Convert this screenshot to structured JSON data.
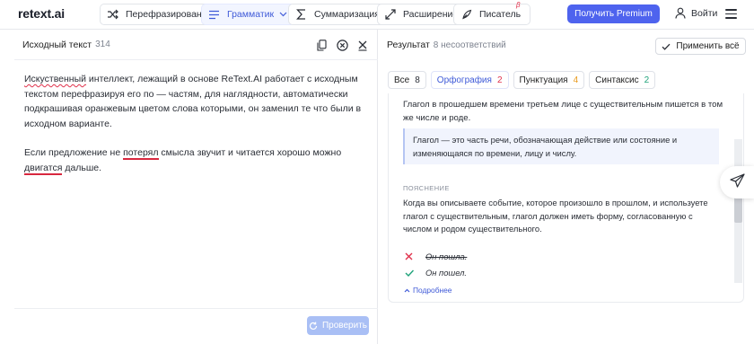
{
  "header": {
    "logo": "retext.ai",
    "nav": [
      {
        "label": "Перефразирование",
        "icon": "shuffle-icon"
      },
      {
        "label": "Грамматик",
        "icon": "text-lines-icon",
        "active": true
      },
      {
        "label": "Суммаризация",
        "icon": "sigma-icon"
      },
      {
        "label": "Расширение",
        "icon": "expand-arrows-icon"
      },
      {
        "label": "Писатель",
        "icon": "quill-icon",
        "badge": "β"
      }
    ],
    "premium_label": "Получить Premium",
    "login_label": "Войти"
  },
  "source_panel": {
    "title": "Исходный текст",
    "count": "314",
    "paragraph1": {
      "error_word": "Искуственный",
      "rest": " интеллект, лежащий в основе ReText.AI работает с исходным текстом перефразируя его по  — частям, для наглядности, автоматически подкрашивая  оранжевым цветом слова которыми, он заменил те что были в исходном варианте."
    },
    "paragraph2": {
      "part1": "Если предложение не ",
      "error1": "потерял",
      "part2": " смысла звучит и читается хорошо можно ",
      "error2": "двигатся",
      "part3": " дальше."
    },
    "check_label": "Проверить"
  },
  "result_panel": {
    "title": "Результат",
    "subtitle": "8 несоответствий",
    "apply_all_label": "Применить всё",
    "tabs": [
      {
        "label": "Все",
        "count": "8",
        "count_color": "#2a2e36"
      },
      {
        "label": "Орфография",
        "count": "2",
        "count_color": "#e0314b"
      },
      {
        "label": "Пунктуация",
        "count": "4",
        "count_color": "#e89a1c"
      },
      {
        "label": "Синтаксис",
        "count": "2",
        "count_color": "#1fa37a"
      }
    ],
    "card": {
      "message": "Глагол в прошедшем времени третьем лице с существительным пишется в том же числе и роде.",
      "definition": "Глагол — это часть речи, обозначающая действие или состояние и изменяющаяся по времени, лицу и числу.",
      "explanation_label": "ПОЯСНЕНИЕ",
      "explanation": "Когда вы описываете событие, которое произошло в прошлом, и используете глагол с существительным, глагол должен иметь форму, согласованную с числом и родом существительного.",
      "wrong_example": "Он пошла.",
      "right_example": "Он пошел.",
      "more_label": "Подробнее"
    }
  },
  "colors": {
    "accent": "#4e63ee",
    "error": "#e0314b",
    "success": "#1fa37a",
    "warning": "#e89a1c"
  }
}
